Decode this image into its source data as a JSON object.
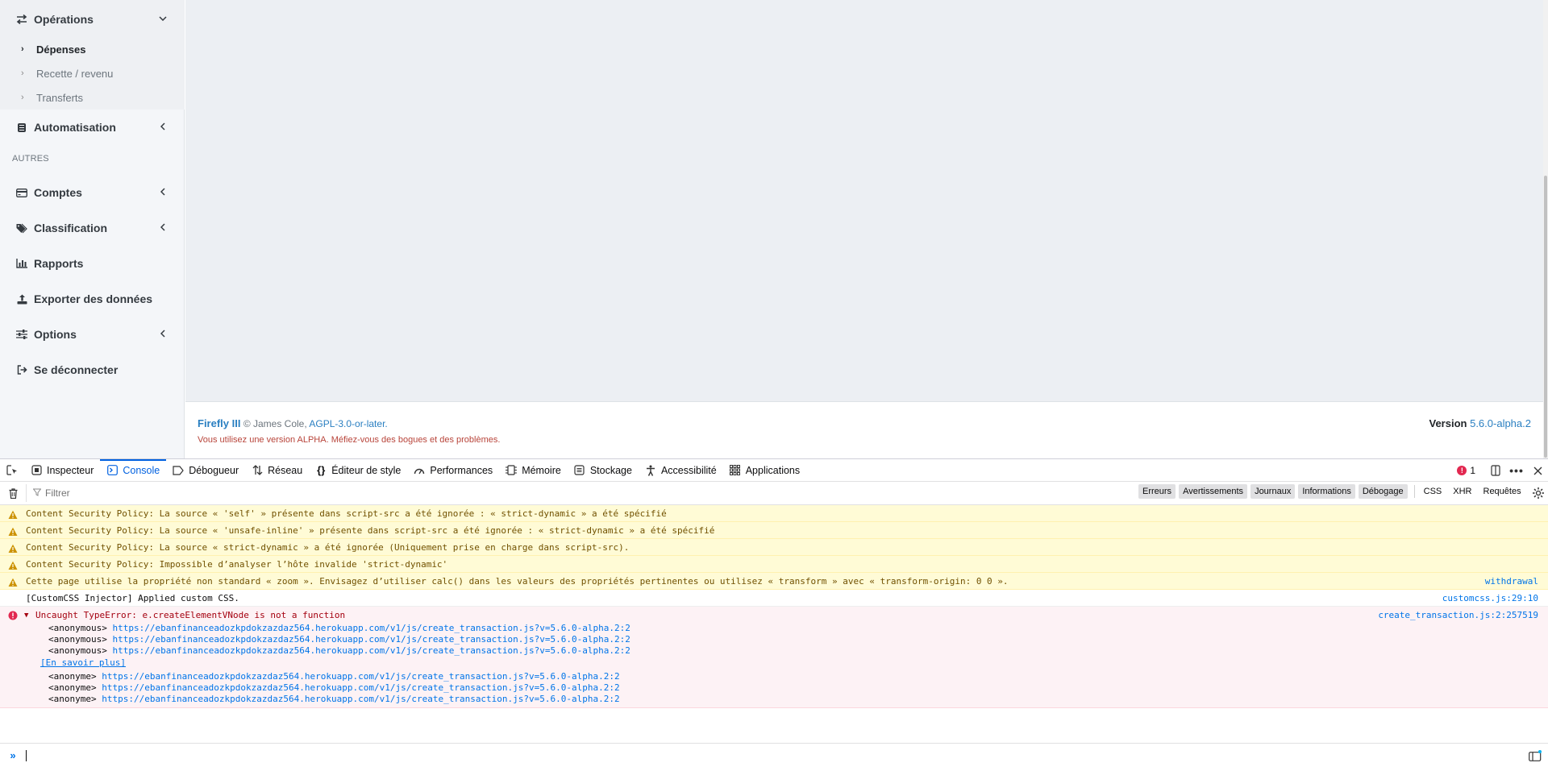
{
  "sidebar": {
    "operations": {
      "label": "Opérations",
      "icon": "exchange-icon"
    },
    "sub_items": [
      {
        "label": "Dépenses",
        "active": true
      },
      {
        "label": "Recette / revenu",
        "active": false
      },
      {
        "label": "Transferts",
        "active": false
      }
    ],
    "automation": {
      "label": "Automatisation",
      "icon": "robot-icon"
    },
    "section_header": "AUTRES",
    "items": [
      {
        "label": "Comptes",
        "icon": "credit-card-icon",
        "has_children": true
      },
      {
        "label": "Classification",
        "icon": "tags-icon",
        "has_children": true
      },
      {
        "label": "Rapports",
        "icon": "bar-chart-icon",
        "has_children": false
      },
      {
        "label": "Exporter des données",
        "icon": "export-icon",
        "has_children": false
      },
      {
        "label": "Options",
        "icon": "sliders-icon",
        "has_children": true
      },
      {
        "label": "Se déconnecter",
        "icon": "sign-out-icon",
        "has_children": false
      }
    ]
  },
  "footer": {
    "brand": "Firefly III",
    "copyright": "© James Cole,",
    "license": "AGPL-3.0-or-later.",
    "warning": "Vous utilisez une version ALPHA. Méfiez-vous des bogues et des problèmes.",
    "version_label": "Version",
    "version_value": "5.6.0-alpha.2"
  },
  "devtools": {
    "tabs": [
      {
        "label": "Inspecteur",
        "icon": "inspector-icon",
        "active": false
      },
      {
        "label": "Console",
        "icon": "console-icon",
        "active": true
      },
      {
        "label": "Débogueur",
        "icon": "debugger-icon",
        "active": false
      },
      {
        "label": "Réseau",
        "icon": "network-icon",
        "active": false
      },
      {
        "label": "Éditeur de style",
        "icon": "style-editor-icon",
        "active": false
      },
      {
        "label": "Performances",
        "icon": "performance-icon",
        "active": false
      },
      {
        "label": "Mémoire",
        "icon": "memory-icon",
        "active": false
      },
      {
        "label": "Stockage",
        "icon": "storage-icon",
        "active": false
      },
      {
        "label": "Accessibilité",
        "icon": "accessibility-icon",
        "active": false
      },
      {
        "label": "Applications",
        "icon": "applications-icon",
        "active": false
      }
    ],
    "error_count": "1",
    "filter_placeholder": "Filtrer",
    "filter_buttons": [
      "Erreurs",
      "Avertissements",
      "Journaux",
      "Informations",
      "Débogage"
    ],
    "filter_buttons_extra": [
      "CSS",
      "XHR",
      "Requêtes"
    ],
    "messages": [
      {
        "type": "warn",
        "text": "Content Security Policy: La source « 'self' » présente dans script-src a été ignorée : « strict-dynamic » a été spécifié",
        "source": ""
      },
      {
        "type": "warn",
        "text": "Content Security Policy: La source « 'unsafe-inline' » présente dans script-src a été ignorée : « strict-dynamic » a été spécifié",
        "source": ""
      },
      {
        "type": "warn",
        "text": "Content Security Policy: La source « strict-dynamic » a été ignorée (Uniquement prise en charge dans script-src).",
        "source": ""
      },
      {
        "type": "warn",
        "text": "Content Security Policy: Impossible d’analyser l’hôte invalide 'strict-dynamic'",
        "source": ""
      },
      {
        "type": "warn",
        "text": "Cette page utilise la propriété non standard « zoom ». Envisagez d’utiliser calc() dans les valeurs des propriétés pertinentes ou utilisez « transform » avec « transform-origin: 0 0 ».",
        "source": "withdrawal"
      },
      {
        "type": "log",
        "text": "[CustomCSS Injector] Applied custom CSS.",
        "source": "customcss.js:29:10"
      }
    ],
    "error": {
      "title": "Uncaught TypeError: e.createElementVNode is not a function",
      "source": "create_transaction.js:2:257519",
      "stack_a": [
        {
          "fn": "<anonymous>",
          "url": "https://ebanfinanceadozkpdokzazdaz564.herokuapp.com/v1/js/create_transaction.js?v=5.6.0-alpha.2:2"
        },
        {
          "fn": "<anonymous>",
          "url": "https://ebanfinanceadozkpdokzazdaz564.herokuapp.com/v1/js/create_transaction.js?v=5.6.0-alpha.2:2"
        },
        {
          "fn": "<anonymous>",
          "url": "https://ebanfinanceadozkpdokzazdaz564.herokuapp.com/v1/js/create_transaction.js?v=5.6.0-alpha.2:2"
        }
      ],
      "learn_more": "[En savoir plus]",
      "stack_b": [
        {
          "fn": "<anonyme>",
          "url": "https://ebanfinanceadozkpdokzazdaz564.herokuapp.com/v1/js/create_transaction.js?v=5.6.0-alpha.2:2"
        },
        {
          "fn": "<anonyme>",
          "url": "https://ebanfinanceadozkpdokzazdaz564.herokuapp.com/v1/js/create_transaction.js?v=5.6.0-alpha.2:2"
        },
        {
          "fn": "<anonyme>",
          "url": "https://ebanfinanceadozkpdokzazdaz564.herokuapp.com/v1/js/create_transaction.js?v=5.6.0-alpha.2:2"
        }
      ]
    }
  }
}
